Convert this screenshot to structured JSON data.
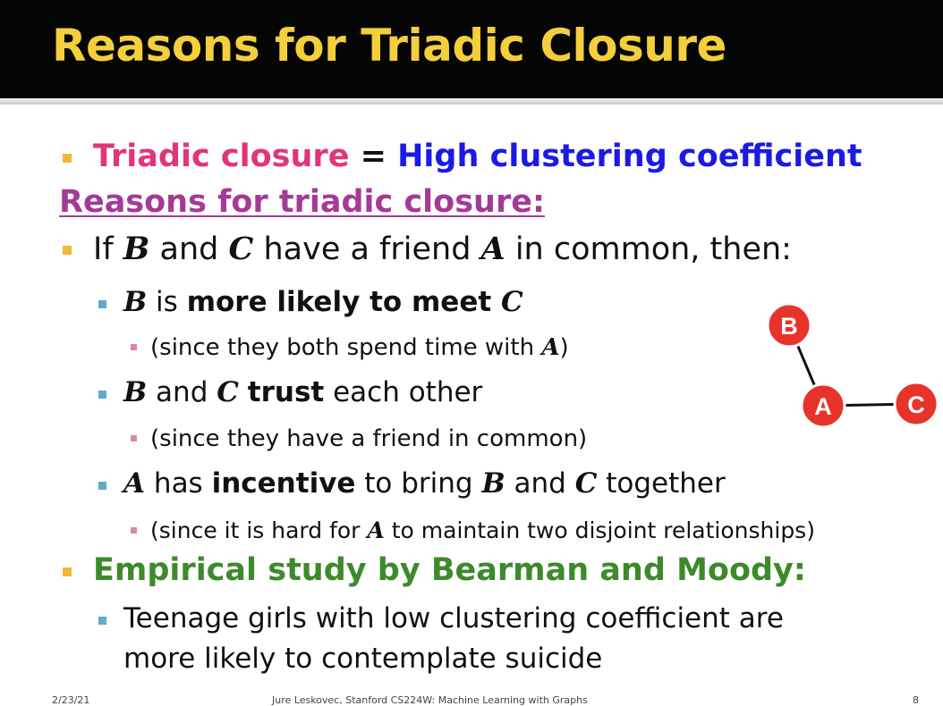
{
  "title": "Reasons for Triadic Closure",
  "bullets": {
    "b1": {
      "term": "Triadic closure",
      "eq": " = ",
      "def": "High clustering coefficient"
    },
    "heading": "Reasons for triadic closure:",
    "b2": {
      "pre": "If ",
      "v1": "B",
      "t1": " and ",
      "v2": "C",
      "t2": " have a friend ",
      "v3": "A",
      "t3": " in common, then:"
    },
    "s1": {
      "v1": "B",
      "t1": " is ",
      "strong": "more likely to meet ",
      "v2": "C"
    },
    "s1a": {
      "pre": "(since they both spend time with ",
      "v": "A",
      "post": ")"
    },
    "s2": {
      "v1": "B",
      "t1": " and ",
      "v2": "C",
      "t2": " ",
      "strong": "trust",
      "t3": " each other"
    },
    "s2a": "(since they have a friend in common)",
    "s3": {
      "v1": "A",
      "t1": " has ",
      "strong": "incentive",
      "t2": " to bring ",
      "v2": "B",
      "t3": " and ",
      "v3": "C",
      "t4": " together"
    },
    "s3a": {
      "pre": "(since it is hard for ",
      "v": "A",
      "post": " to maintain two disjoint relationships)"
    },
    "b3": "Empirical study by Bearman and Moody:",
    "s4": {
      "line1": "Teenage girls with low clustering coefficient are",
      "line2": "more likely to contemplate suicide"
    }
  },
  "graph": {
    "node_b": "B",
    "node_a": "A",
    "node_c": "C",
    "node_color": "#e8332a"
  },
  "footer": {
    "date": "2/23/21",
    "credit": "Jure Leskovec, Stanford CS224W: Machine Learning with Graphs",
    "page": "8"
  }
}
